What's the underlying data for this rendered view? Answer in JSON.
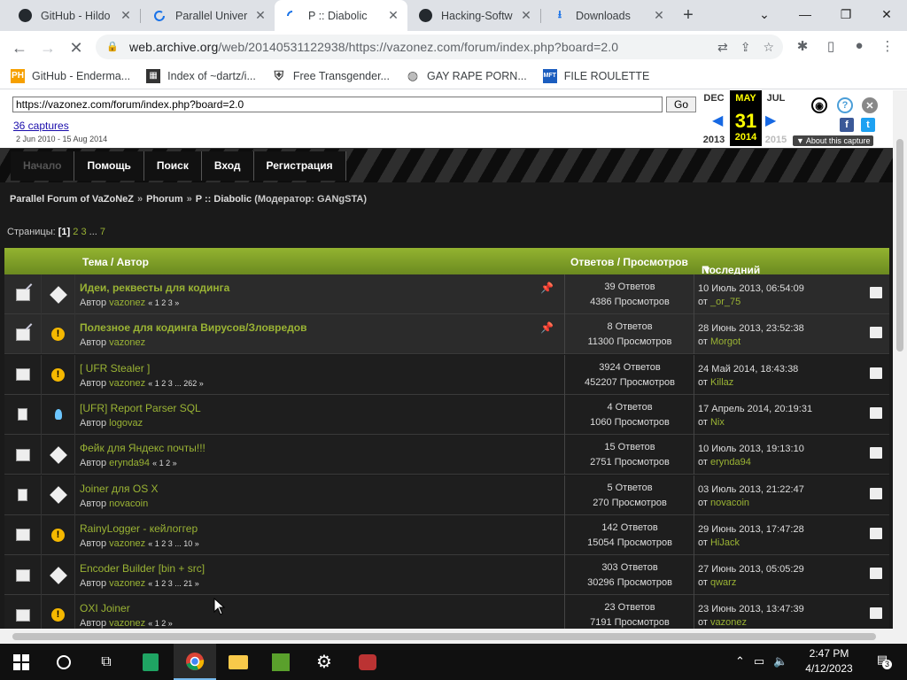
{
  "tabs": [
    {
      "title": "GitHub - Hildo",
      "icon": "github-icon"
    },
    {
      "title": "Parallel Univer",
      "icon": "loading-icon"
    },
    {
      "title": "P :: Diabolic",
      "icon": "loading-icon"
    },
    {
      "title": "Hacking-Softw",
      "icon": "github-icon"
    },
    {
      "title": "Downloads",
      "icon": "download-icon"
    }
  ],
  "url": {
    "host": "web.archive.org",
    "path": "/web/20140531122938/https://vazonez.com/forum/index.php?board=2.0"
  },
  "bookmarks": [
    {
      "label": "GitHub - Enderma...",
      "icon": "PH"
    },
    {
      "label": "Index of ~dartz/i...",
      "icon": "puzzle"
    },
    {
      "label": "Free Transgender...",
      "icon": "shield"
    },
    {
      "label": "GAY RAPE PORN...",
      "icon": "globe"
    },
    {
      "label": "FILE ROULETTE",
      "icon": "MFT"
    }
  ],
  "wayback": {
    "url_value": "https://vazonez.com/forum/index.php?board=2.0",
    "go": "Go",
    "captures": "36 captures",
    "range": "2 Jun 2010 - 15 Aug 2014",
    "prev_month": "DEC",
    "prev_year": "2013",
    "cur_month": "MAY",
    "cur_day": "31",
    "cur_year": "2014",
    "next_month": "JUL",
    "next_year": "2015",
    "about": "▼ About this capture"
  },
  "menu": [
    "Начало",
    "Помощь",
    "Поиск",
    "Вход",
    "Регистрация"
  ],
  "crumb": {
    "a": "Parallel Forum of VaZoNeZ",
    "b": "Phorum",
    "c": "P :: Diabolic",
    "mod": "(Модератор: GANgSTA)"
  },
  "pages": {
    "label": "Страницы:",
    "cur": "[1]",
    "p2": "2",
    "p3": "3",
    "dots": "...",
    "last": "7"
  },
  "thead": {
    "topic": "Тема / Автор",
    "stats": "Ответов / Просмотров",
    "last": "Последний ответ"
  },
  "author_label": "Автор",
  "from_label": "от",
  "rows": [
    {
      "title": "Идеи, реквесты для кодинга",
      "author": "vazonez",
      "pages": "« 1 2 3 »",
      "replies": "39 Ответов",
      "views": "4386 Просмотров",
      "date": "10 Июль 2013, 06:54:09",
      "by": "_or_75"
    },
    {
      "title": "Полезное для кодинга Вирусов/Зловредов",
      "author": "vazonez",
      "pages": "",
      "replies": "8 Ответов",
      "views": "11300 Просмотров",
      "date": "28 Июнь 2013, 23:52:38",
      "by": "Morgot"
    },
    {
      "title": "[ UFR Stealer ]",
      "author": "vazonez",
      "pages": "« 1 2 3 ... 262 »",
      "replies": "3924 Ответов",
      "views": "452207 Просмотров",
      "date": "24 Май 2014, 18:43:38",
      "by": "Killaz"
    },
    {
      "title": "[UFR] Report Parser SQL",
      "author": "logovaz",
      "pages": "",
      "replies": "4 Ответов",
      "views": "1060 Просмотров",
      "date": "17 Апрель 2014, 20:19:31",
      "by": "Nix"
    },
    {
      "title": "Фейк для Яндекс почты!!!",
      "author": "erynda94",
      "pages": "« 1 2 »",
      "replies": "15 Ответов",
      "views": "2751 Просмотров",
      "date": "10 Июль 2013, 19:13:10",
      "by": "erynda94"
    },
    {
      "title": "Joiner для OS X",
      "author": "novacoin",
      "pages": "",
      "replies": "5 Ответов",
      "views": "270 Просмотров",
      "date": "03 Июль 2013, 21:22:47",
      "by": "novacoin"
    },
    {
      "title": "RainyLogger - кейлоггер",
      "author": "vazonez",
      "pages": "« 1 2 3 ... 10 »",
      "replies": "142 Ответов",
      "views": "15054 Просмотров",
      "date": "29 Июнь 2013, 17:47:28",
      "by": "HiJack"
    },
    {
      "title": "Encoder Builder [bin + src]",
      "author": "vazonez",
      "pages": "« 1 2 3 ... 21 »",
      "replies": "303 Ответов",
      "views": "30296 Просмотров",
      "date": "27 Июнь 2013, 05:05:29",
      "by": "qwarz"
    },
    {
      "title": "OXI Joiner",
      "author": "vazonez",
      "pages": "« 1 2 »",
      "replies": "23 Ответов",
      "views": "7191 Просмотров",
      "date": "23 Июнь 2013, 13:47:39",
      "by": "vazonez"
    }
  ],
  "clock": {
    "time": "2:47 PM",
    "date": "4/12/2023"
  },
  "notif_count": "3"
}
